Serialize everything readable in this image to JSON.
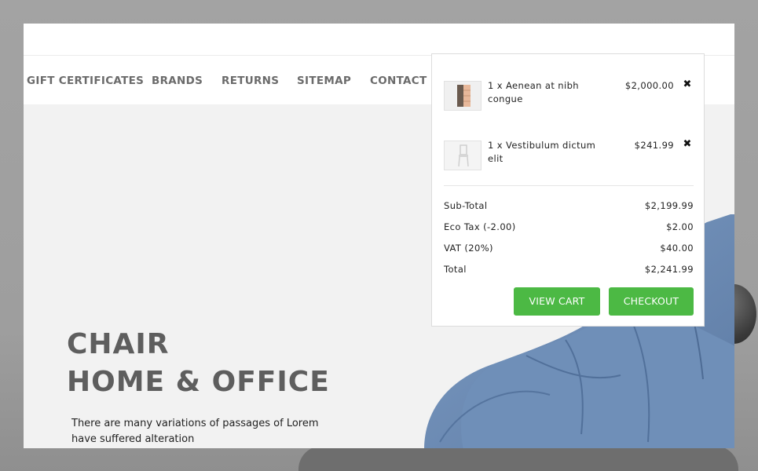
{
  "nav": {
    "items": [
      {
        "label": "Gift Certificates"
      },
      {
        "label": "Brands"
      },
      {
        "label": "Returns"
      },
      {
        "label": "Sitemap"
      },
      {
        "label": "Contact Us"
      }
    ]
  },
  "hero": {
    "title_line1": "CHAIR",
    "title_line2": "HOME & OFFICE",
    "text": "There are many variations of passages of Lorem have suffered alteration"
  },
  "cart": {
    "items": [
      {
        "qty": "1 x",
        "name": "Aenean at nibh congue",
        "price": "$2,000.00",
        "thumb_icon": "dresser-thumbnail"
      },
      {
        "qty": "1 x",
        "name": "Vestibulum dictum elit",
        "price": "$241.99",
        "thumb_icon": "chair-thumbnail"
      }
    ],
    "remove_icon": "✖",
    "totals": [
      {
        "label": "Sub-Total",
        "value": "$2,199.99"
      },
      {
        "label": "Eco Tax (-2.00)",
        "value": "$2.00"
      },
      {
        "label": "VAT (20%)",
        "value": "$40.00"
      },
      {
        "label": "Total",
        "value": "$2,241.99"
      }
    ],
    "view_cart_label": "View Cart",
    "checkout_label": "Checkout"
  },
  "colors": {
    "accent_green": "#4cb944",
    "nav_text": "#6b6b6b",
    "hero_title": "#5e5e5e",
    "chair_blue": "#6f8fb8"
  }
}
